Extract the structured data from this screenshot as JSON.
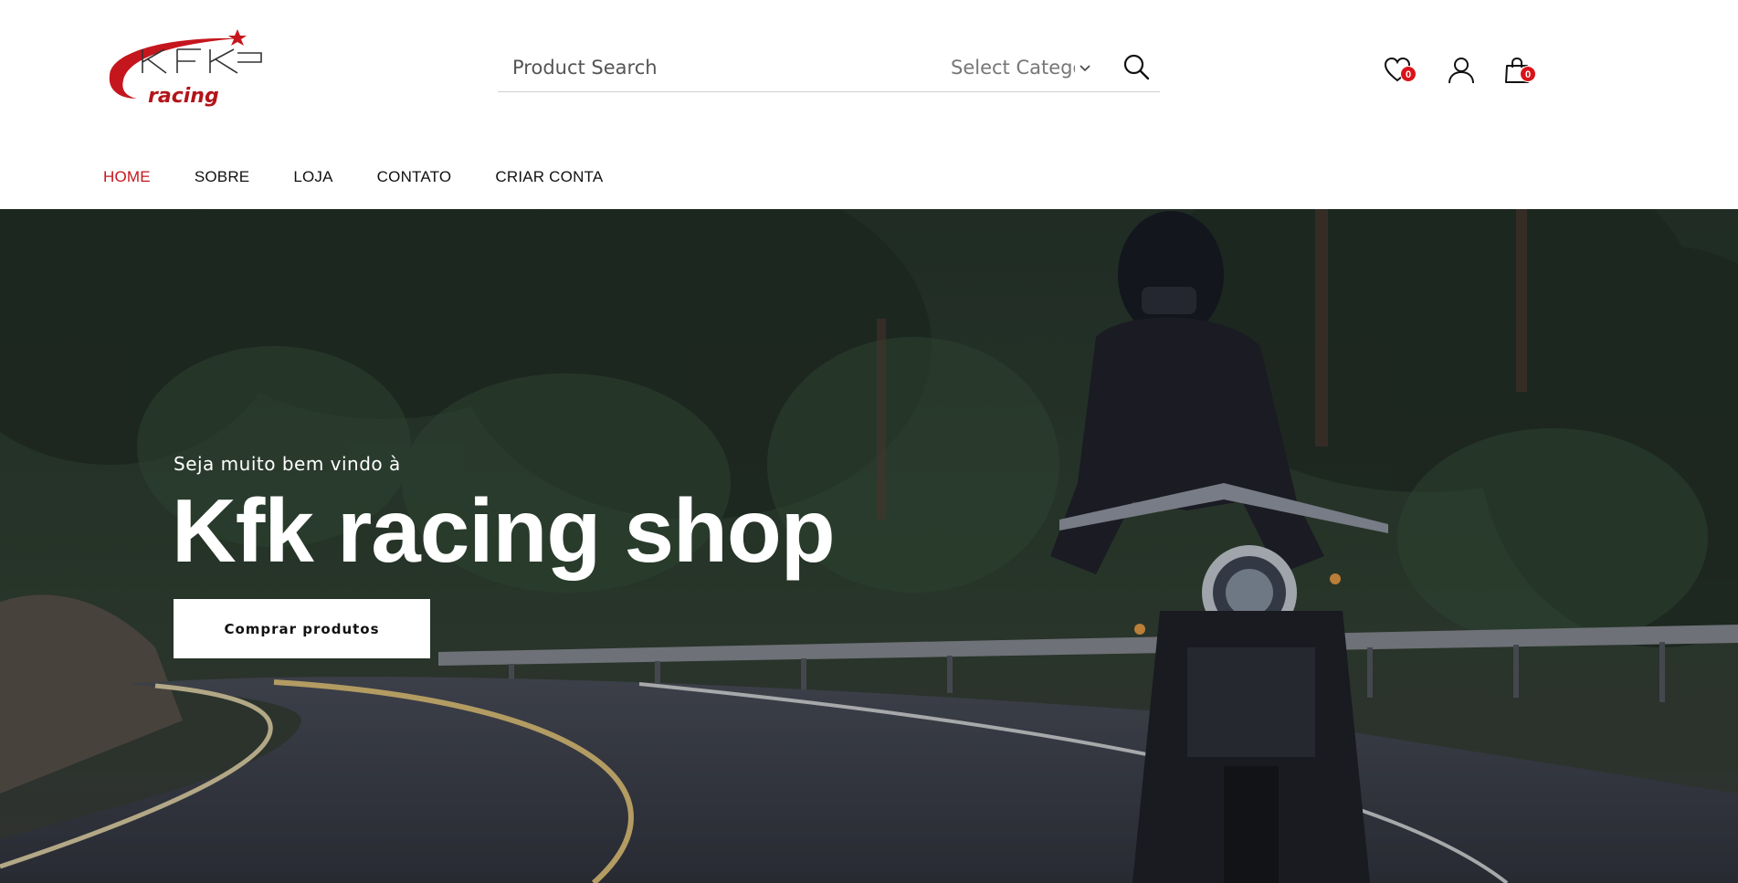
{
  "brand": {
    "logo_main": "KFK",
    "logo_sub": "racing",
    "accent_color": "#c5161d"
  },
  "search": {
    "placeholder": "Product Search",
    "category_label": "Select Category",
    "search_icon": "search-icon"
  },
  "header_icons": {
    "wishlist_count": "0",
    "cart_count": "0",
    "icons": [
      "heart-icon",
      "user-icon",
      "shopping-bag-icon"
    ]
  },
  "nav": {
    "items": [
      {
        "label": "HOME",
        "active": true
      },
      {
        "label": "SOBRE",
        "active": false
      },
      {
        "label": "LOJA",
        "active": false
      },
      {
        "label": "CONTATO",
        "active": false
      },
      {
        "label": "CRIAR CONTA",
        "active": false
      }
    ]
  },
  "hero": {
    "subtitle": "Seja muito bem vindo à",
    "title": "Kfk racing shop",
    "button_label": "Comprar produtos"
  }
}
